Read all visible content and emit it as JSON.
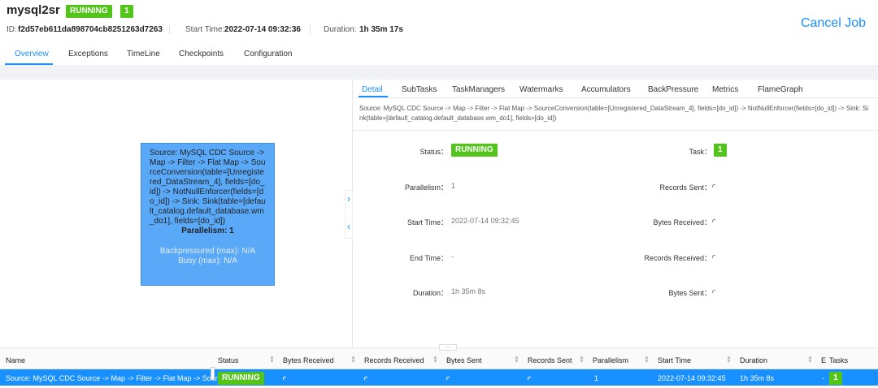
{
  "job": {
    "name": "mysql2sr",
    "status": "RUNNING",
    "count": "1",
    "id_label": "ID:",
    "id": "f2d57eb611da898704cb8251263d7263",
    "start_label": "Start Time:",
    "start": "2022-07-14 09:32:36",
    "duration_label": "Duration:",
    "duration": "1h 35m 17s",
    "cancel_label": "Cancel Job"
  },
  "tabs": [
    "Overview",
    "Exceptions",
    "TimeLine",
    "Checkpoints",
    "Configuration"
  ],
  "graph": {
    "node_desc": "Source: MySQL CDC Source -> Map -> Filter -> Flat Map -> SourceConversion(table=[Unregistered_DataStream_4], fields=[do_id]) -> NotNullEnforcer(fields=[do_id]) -> Sink: Sink(table=[default_catalog.default_database.wm_do1], fields=[do_id])",
    "parallelism": "Parallelism: 1",
    "backpressured": "Backpressured (max): N/A",
    "busy": "Busy (max): N/A"
  },
  "detail": {
    "tabs": [
      "Detail",
      "SubTasks",
      "TaskManagers",
      "Watermarks",
      "Accumulators",
      "BackPressure",
      "Metrics",
      "FlameGraph"
    ],
    "vertex_name": "Source: MySQL CDC Source -> Map -> Filter -> Flat Map -> SourceConversion(table=[Unregistered_DataStream_4], fields=[do_id]) -> NotNullEnforcer(fields=[do_id]) -> Sink: Sink(table=[default_catalog.default_database.wm_do1], fields=[do_id])",
    "status_label": "Status：",
    "status": "RUNNING",
    "task_label": "Task：",
    "task": "1",
    "parallelism_label": "Parallelism：",
    "parallelism": "1",
    "records_sent_label": "Records Sent：",
    "start_label": "Start Time：",
    "start": "2022-07-14 09:32:45",
    "bytes_received_label": "Bytes Received：",
    "end_label": "End Time：",
    "end": "-",
    "records_received_label": "Records Received：",
    "duration_label": "Duration：",
    "duration": "1h 35m 8s",
    "bytes_sent_label": "Bytes Sent："
  },
  "table": {
    "resize_handle": "...",
    "headers": [
      "Name",
      "Status",
      "Bytes Received",
      "Records Received",
      "Bytes Sent",
      "Records Sent",
      "Parallelism",
      "Start Time",
      "Duration",
      "E",
      "Tasks"
    ],
    "row": {
      "name": "Source: MySQL CDC Source -> Map -> Filter -> Flat Map -> SourceC...",
      "status": "RUNNING",
      "parallelism": "1",
      "start": "2022-07-14 09:32:45",
      "duration": "1h 35m 8s",
      "end": "-",
      "tasks": "1"
    }
  }
}
